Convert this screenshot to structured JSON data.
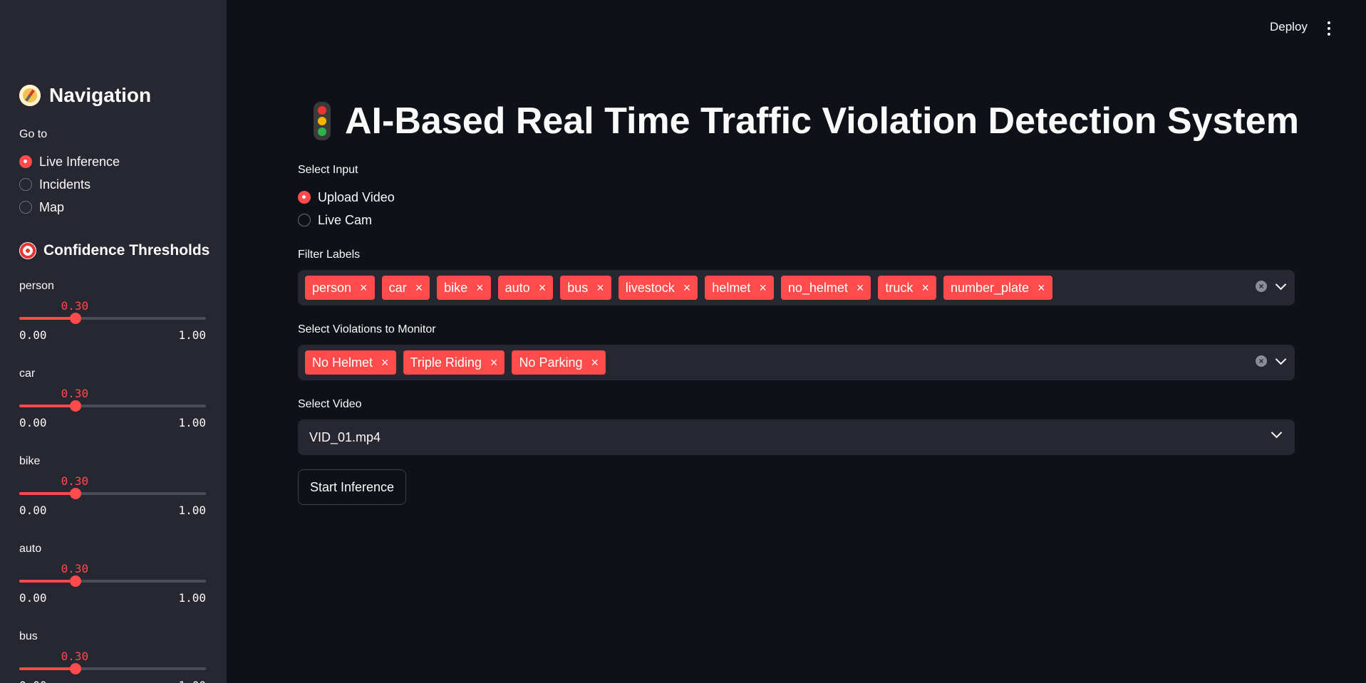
{
  "colors": {
    "accent": "#ff4b4b",
    "background": "#0e1117",
    "sidebar": "#262730"
  },
  "sidebar": {
    "nav_title": "Navigation",
    "goto_label": "Go to",
    "nav_options": [
      "Live Inference",
      "Incidents",
      "Map"
    ],
    "nav_selected": "Live Inference",
    "conf_title": "Confidence Thresholds",
    "sliders": [
      {
        "label": "person",
        "value": "0.30",
        "min": "0.00",
        "max": "1.00",
        "fraction": 0.3
      },
      {
        "label": "car",
        "value": "0.30",
        "min": "0.00",
        "max": "1.00",
        "fraction": 0.3
      },
      {
        "label": "bike",
        "value": "0.30",
        "min": "0.00",
        "max": "1.00",
        "fraction": 0.3
      },
      {
        "label": "auto",
        "value": "0.30",
        "min": "0.00",
        "max": "1.00",
        "fraction": 0.3
      },
      {
        "label": "bus",
        "value": "0.30",
        "min": "0.00",
        "max": "1.00",
        "fraction": 0.3
      }
    ]
  },
  "topbar": {
    "deploy_label": "Deploy"
  },
  "main": {
    "title": "AI-Based Real Time Traffic Violation Detection System",
    "input_label": "Select Input",
    "input_options": [
      "Upload Video",
      "Live Cam"
    ],
    "input_selected": "Upload Video",
    "filter_label": "Filter Labels",
    "filter_tags": [
      "person",
      "car",
      "bike",
      "auto",
      "bus",
      "livestock",
      "helmet",
      "no_helmet",
      "truck",
      "number_plate"
    ],
    "violations_label": "Select Violations to Monitor",
    "violation_tags": [
      "No Helmet",
      "Triple Riding",
      "No Parking"
    ],
    "video_label": "Select Video",
    "video_selected": "VID_01.mp4",
    "start_button": "Start Inference"
  }
}
